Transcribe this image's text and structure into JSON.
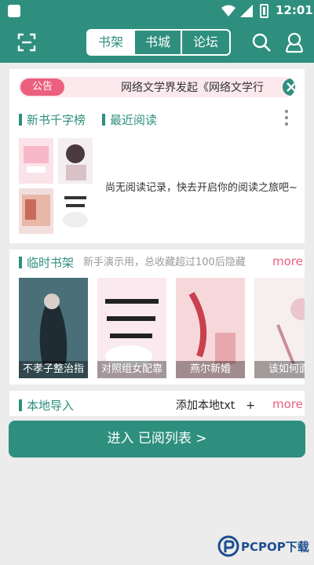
{
  "statusbar": {
    "time": "12:01"
  },
  "header": {
    "tabs": [
      {
        "label": "书架",
        "active": true
      },
      {
        "label": "书城",
        "active": false
      },
      {
        "label": "论坛",
        "active": false
      }
    ],
    "icons": [
      "scan-icon",
      "search-icon",
      "user-icon"
    ]
  },
  "notice": {
    "tag": "公告",
    "text": "网络文学界发起《网络文学行"
  },
  "sections": {
    "new_books": "新书千字榜",
    "recent": "最近阅读",
    "recent_empty": "尚无阅读记录，快去开启你的阅读之旅吧~",
    "temp_shelf": "临时书架",
    "temp_hint": "新手演示用，总收藏超过100后隐藏",
    "more": "more",
    "local_import": "本地导入",
    "add_local": "添加本地txt　+"
  },
  "temp_books": [
    {
      "title": "不孝子整治指",
      "color": "#4a6f78"
    },
    {
      "title": "对照组女配靠",
      "color": "#f2c8d3"
    },
    {
      "title": "燕尔新婚",
      "color": "#f0c4c9"
    },
    {
      "title": "该如何面",
      "color": "#f4e6e8"
    }
  ],
  "enter_button": "进入 已阅列表 >",
  "watermark": {
    "text": "PCPOP下载"
  },
  "colors": {
    "primary": "#2e8f7e",
    "accent": "#ec5f7e",
    "background": "#ececec"
  }
}
